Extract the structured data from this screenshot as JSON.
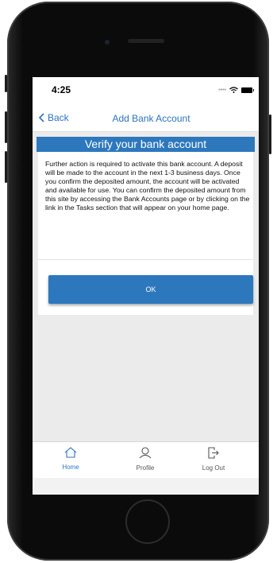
{
  "status_bar": {
    "time": "4:25"
  },
  "nav": {
    "back_label": "Back",
    "title": "Add Bank Account"
  },
  "banner": {
    "title": "Verify your bank account"
  },
  "message": "Further action is required to activate this bank account. A deposit will be made to the account in the next 1-3 business days. Once you confirm the deposited amount, the account will be activated and available for use. You can confirm the deposited amount from this site by accessing the Bank Accounts page or by clicking on the link in the Tasks section that will appear on your home page.",
  "actions": {
    "ok_label": "OK"
  },
  "tabs": [
    {
      "label": "Home",
      "icon": "home-icon",
      "active": true
    },
    {
      "label": "Profile",
      "icon": "profile-icon",
      "active": false
    },
    {
      "label": "Log Out",
      "icon": "logout-icon",
      "active": false
    }
  ],
  "colors": {
    "accent": "#2d78bd",
    "link": "#2d73c2",
    "background": "#ebebeb"
  }
}
